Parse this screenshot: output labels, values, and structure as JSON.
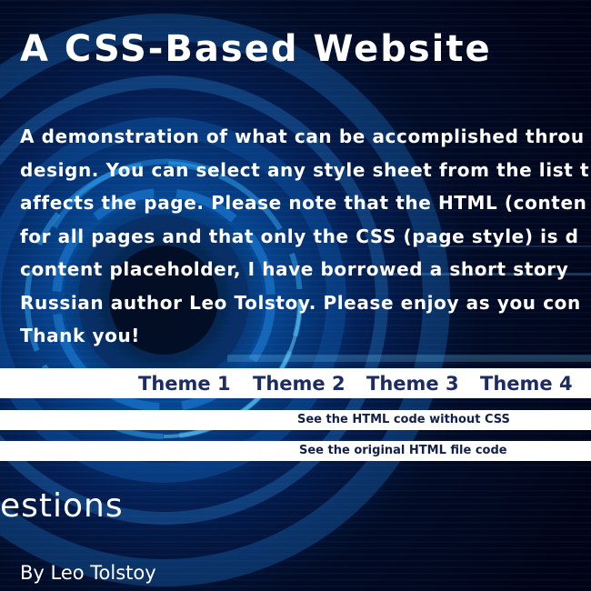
{
  "header": {
    "title": "A CSS-Based Website"
  },
  "intro": {
    "lines": [
      "A demonstration of what can be accomplished throu",
      "design. You can select any style sheet from the list t",
      "affects the page. Please note that the HTML (conten",
      "for all pages and that only the CSS (page style) is d",
      "content placeholder, I have borrowed a short story",
      "Russian author Leo Tolstoy. Please enjoy as you con",
      "Thank you!"
    ]
  },
  "themes": {
    "items": [
      "Theme 1",
      "Theme 2",
      "Theme 3",
      "Theme 4"
    ]
  },
  "links": {
    "no_css": "See the HTML code without CSS",
    "original": "See the original HTML file code"
  },
  "story": {
    "title": "estions",
    "byline": "By Leo Tolstoy"
  },
  "colors": {
    "theme_link": "#1d2d62",
    "bar_link": "#12204a",
    "background": "#010b26",
    "glow": "#0b70c9"
  }
}
